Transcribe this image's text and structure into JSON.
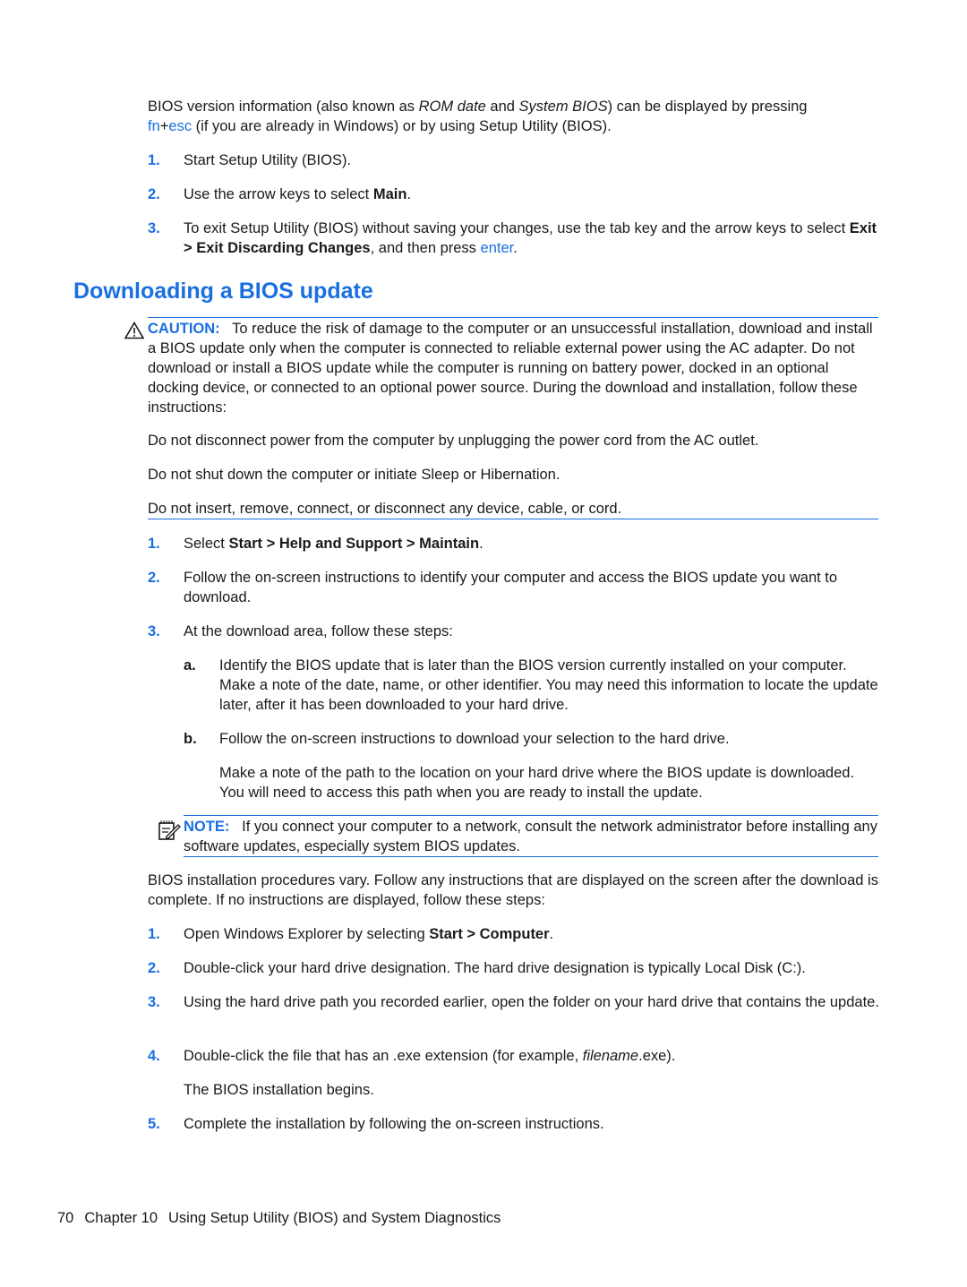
{
  "intro": {
    "text_1": "BIOS version information (also known as ",
    "em_1": "ROM date",
    "text_2": " and ",
    "em_2": "System BIOS",
    "text_3": ") can be displayed by pressing",
    "key_fn": "fn",
    "plus": "+",
    "key_esc": "esc",
    "text_4": " (if you are already in Windows) or by using Setup Utility (BIOS)."
  },
  "steps_view": [
    {
      "num": "1.",
      "text": "Start Setup Utility (BIOS)."
    },
    {
      "num": "2.",
      "pre": "Use the arrow keys to select ",
      "bold": "Main",
      "post": "."
    },
    {
      "num": "3.",
      "pre": "To exit Setup Utility (BIOS) without saving your changes, use the tab key and the arrow keys to select ",
      "bold": "Exit > Exit Discarding Changes",
      "mid": ", and then press ",
      "key": "enter",
      "post": "."
    }
  ],
  "section": {
    "heading": "Downloading a BIOS update"
  },
  "caution": {
    "icon": "warning-triangle-icon",
    "label": "CAUTION:",
    "text": "To reduce the risk of damage to the computer or an unsuccessful installation, download and install a BIOS update only when the computer is connected to reliable external power using the AC adapter. Do not download or install a BIOS update while the computer is running on battery power, docked in an optional docking device, or connected to an optional power source. During the download and installation, follow these instructions:",
    "items": [
      "Do not disconnect power from the computer by unplugging the power cord from the AC outlet.",
      "Do not shut down the computer or initiate Sleep or Hibernation.",
      "Do not insert, remove, connect, or disconnect any device, cable, or cord."
    ]
  },
  "download_steps": [
    {
      "num": "1.",
      "pre": "Select ",
      "bold": "Start > Help and Support > Maintain",
      "post": "."
    },
    {
      "num": "2.",
      "text": "Follow the on-screen instructions to identify your computer and access the BIOS update you want to download."
    },
    {
      "num": "3.",
      "text": "At the download area, follow these steps:"
    }
  ],
  "sub_steps": [
    {
      "num": "a.",
      "text": "Identify the BIOS update that is later than the BIOS version currently installed on your computer. Make a note of the date, name, or other identifier. You may need this information to locate the update later, after it has been downloaded to your hard drive."
    },
    {
      "num": "b.",
      "text": "Follow the on-screen instructions to download your selection to the hard drive."
    }
  ],
  "sub_note": "Make a note of the path to the location on your hard drive where the BIOS update is downloaded. You will need to access this path when you are ready to install the update.",
  "note": {
    "icon": "note-pencil-icon",
    "label": "NOTE:",
    "text": "If you connect your computer to a network, consult the network administrator before installing any software updates, especially system BIOS updates."
  },
  "install_intro": "BIOS installation procedures vary. Follow any instructions that are displayed on the screen after the download is complete. If no instructions are displayed, follow these steps:",
  "install_steps": [
    {
      "num": "1.",
      "pre": "Open Windows Explorer by selecting ",
      "bold": "Start > Computer",
      "post": "."
    },
    {
      "num": "2.",
      "text": "Double-click your hard drive designation. The hard drive designation is typically Local Disk (C:)."
    },
    {
      "num": "3.",
      "text": "Using the hard drive path you recorded earlier, open the folder on your hard drive that contains the update."
    },
    {
      "num": "4.",
      "pre": "Double-click the file that has an .exe extension (for example, ",
      "em": "filename",
      "post": ".exe)."
    },
    {
      "num": "5.",
      "text": "Complete the installation by following the on-screen instructions."
    }
  ],
  "install_step4_result": "The BIOS installation begins.",
  "footer": {
    "page_number": "70",
    "chapter": "Chapter 10",
    "chapter_title": "Using Setup Utility (BIOS) and System Diagnostics"
  },
  "colors": {
    "accent": "#1a6fe0",
    "text": "#1a1a1a"
  }
}
